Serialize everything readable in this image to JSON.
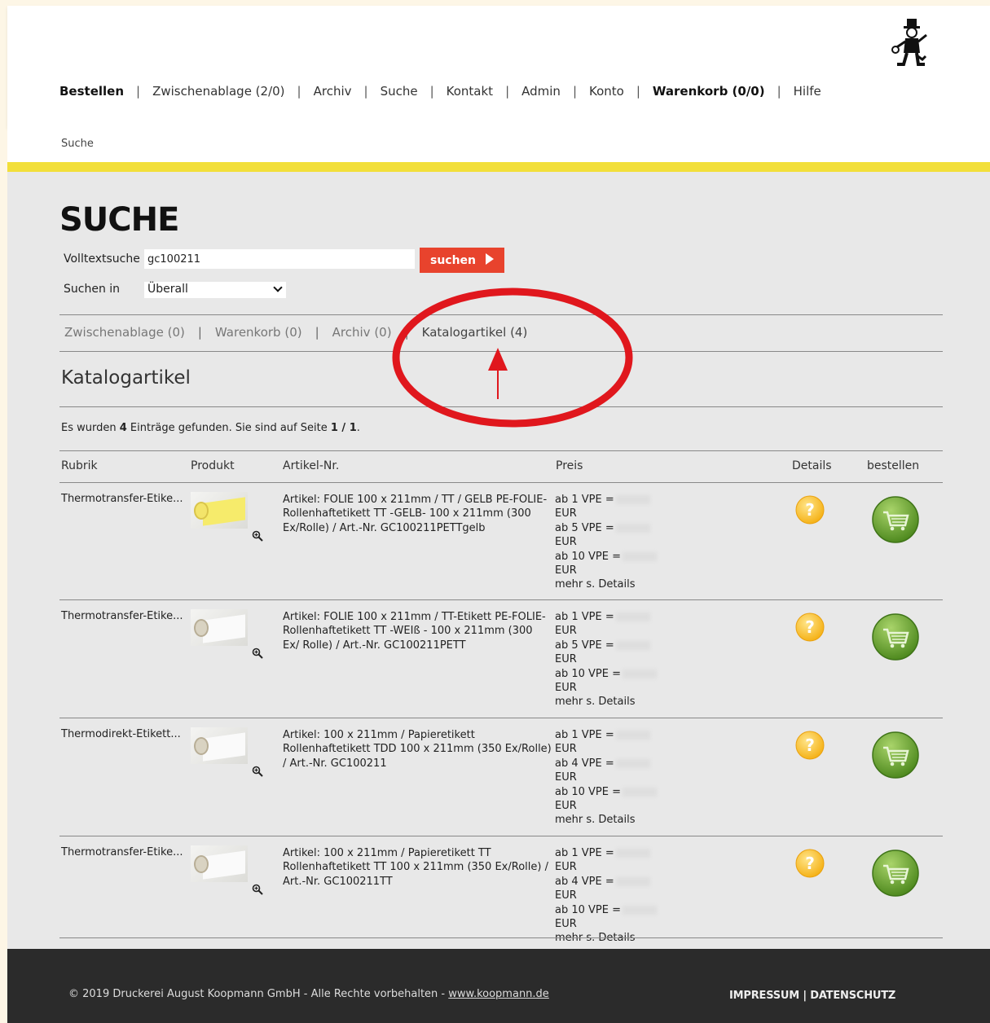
{
  "nav": {
    "items": [
      "Bestellen",
      "Zwischenablage (2/0)",
      "Archiv",
      "Suche",
      "Kontakt",
      "Admin",
      "Konto",
      "Warenkorb (0/0)",
      "Hilfe"
    ],
    "separator": "|"
  },
  "breadcrumb": "Suche",
  "page_title": "SUCHE",
  "search": {
    "fulltext_label": "Volltextsuche",
    "fulltext_value": "gc100211",
    "button_label": "suchen",
    "scope_label": "Suchen in",
    "scope_value": "Überall"
  },
  "tabs": [
    "Zwischenablage (0)",
    "Warenkorb (0)",
    "Archiv (0)",
    "Katalogartikel (4)"
  ],
  "section_title": "Katalogartikel",
  "results": {
    "prefix": "Es wurden ",
    "count": "4",
    "middle": " Einträge gefunden. Sie sind auf Seite ",
    "page": "1 / 1",
    "suffix": "."
  },
  "table": {
    "headers": [
      "Rubrik",
      "Produkt",
      "Artikel-Nr.",
      "Preis",
      "Details",
      "bestellen"
    ],
    "rows": [
      {
        "rubrik": "Thermotransfer-Etike...",
        "article": "Artikel: FOLIE 100 x 211mm / TT / GELB PE-FOLIE-Rollenhaftetikett TT -GELB- 100 x 211mm (300 Ex/Rolle) / Art.-Nr. GC100211PETTgelb",
        "price_lines": [
          "ab 1 VPE =",
          "EUR",
          "ab 5 VPE =",
          "EUR",
          "ab 10 VPE =",
          "EUR",
          "mehr s. Details"
        ]
      },
      {
        "rubrik": "Thermotransfer-Etike...",
        "article": "Artikel: FOLIE 100 x 211mm / TT-Etikett PE-FOLIE-Rollenhaftetikett TT -WEIß - 100 x 211mm (300 Ex/ Rolle) / Art.-Nr. GC100211PETT",
        "price_lines": [
          "ab 1 VPE =",
          "EUR",
          "ab 5 VPE =",
          "EUR",
          "ab 10 VPE =",
          "EUR",
          "mehr s. Details"
        ]
      },
      {
        "rubrik": "Thermodirekt-Etikett...",
        "article": "Artikel: 100 x 211mm / Papieretikett Rollenhaftetikett TDD 100 x 211mm (350 Ex/Rolle) / Art.-Nr. GC100211",
        "price_lines": [
          "ab 1 VPE =",
          "EUR",
          "ab 4 VPE =",
          "EUR",
          "ab 10 VPE =",
          "EUR",
          "mehr s. Details"
        ]
      },
      {
        "rubrik": "Thermotransfer-Etike...",
        "article": "Artikel: 100 x 211mm / Papieretikett TT Rollenhaftetikett TT 100 x 211mm (350 Ex/Rolle) / Art.-Nr. GC100211TT",
        "price_lines": [
          "ab 1 VPE =",
          "EUR",
          "ab 4 VPE =",
          "EUR",
          "ab 10 VPE =",
          "EUR",
          "mehr s. Details"
        ]
      }
    ]
  },
  "footer": {
    "copyright": "© 2019 Druckerei August Koopmann GmbH - Alle Rechte vorbehalten - ",
    "link": "www.koopmann.de",
    "legal": "IMPRESSUM | DATENSCHUTZ"
  },
  "colors": {
    "accent_yellow": "#f2df3a",
    "button_red": "#e8432d",
    "annotation_red": "#e0171d",
    "footer_bg": "#2b2b2b"
  },
  "icons": {
    "logo": "chimney-sweep-logo",
    "zoom": "zoom-icon",
    "details": "question-icon",
    "order": "cart-icon"
  }
}
